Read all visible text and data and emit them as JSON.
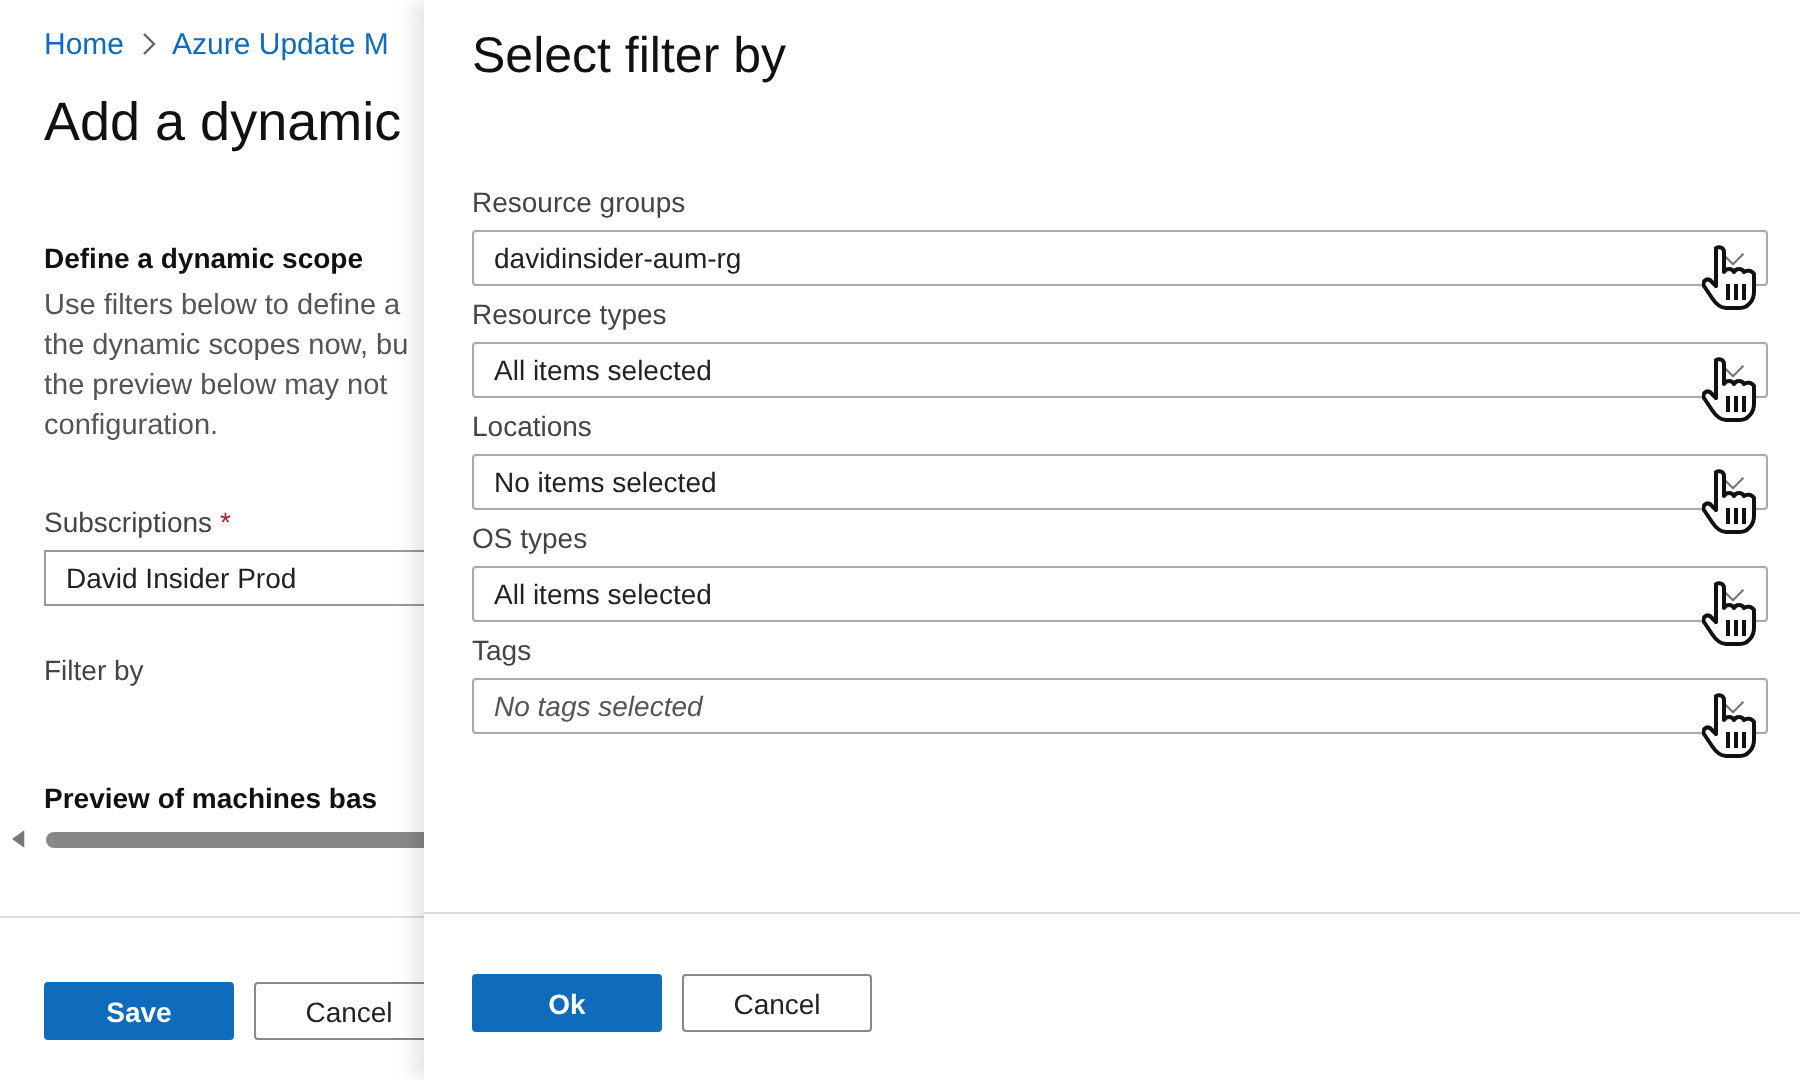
{
  "background_page": {
    "breadcrumb": [
      "Home",
      "Azure Update M"
    ],
    "title": "Add a dynamic",
    "section_heading": "Define a dynamic scope",
    "description": "Use filters below to define a\nthe dynamic scopes now, bu\nthe preview below may not\nconfiguration.",
    "subscriptions": {
      "label": "Subscriptions",
      "required_mark": "*",
      "value": "David Insider Prod"
    },
    "filter_label": "Filter by",
    "preview_heading": "Preview of machines bas",
    "buttons": [
      {
        "label": "Save",
        "kind": "primary"
      },
      {
        "label": "Cancel",
        "kind": "secondary"
      }
    ]
  },
  "panel": {
    "title": "Select filter by",
    "filters": [
      {
        "label": "Resource groups",
        "value": "davidinsider-aum-rg"
      },
      {
        "label": "Resource types",
        "value": "All items selected"
      },
      {
        "label": "Locations",
        "value": "No items selected"
      },
      {
        "label": "OS types",
        "value": "All items selected"
      },
      {
        "label": "Tags",
        "placeholder": "No tags selected"
      }
    ],
    "buttons": [
      {
        "label": "Ok",
        "kind": "primary"
      },
      {
        "label": "Cancel",
        "kind": "secondary"
      }
    ]
  }
}
